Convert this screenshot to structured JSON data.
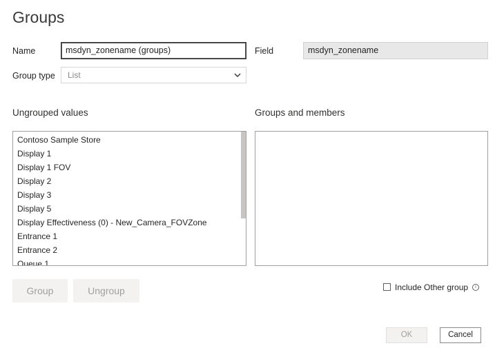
{
  "dialog": {
    "title": "Groups",
    "name_label": "Name",
    "name_value": "msdyn_zonename (groups)",
    "field_label": "Field",
    "field_value": "msdyn_zonename",
    "group_type_label": "Group type",
    "group_type_value": "List",
    "ungrouped_heading": "Ungrouped values",
    "groups_heading": "Groups and members",
    "ungrouped_values": [
      "Contoso Sample Store",
      "Display 1",
      "Display 1 FOV",
      "Display 2",
      "Display 3",
      "Display 5",
      "Display Effectiveness (0) - New_Camera_FOVZone",
      "Entrance 1",
      "Entrance 2",
      "Queue 1"
    ],
    "group_button": "Group",
    "ungroup_button": "Ungroup",
    "include_other_label": "Include Other group",
    "info_icon": "i",
    "ok_button": "OK",
    "cancel_button": "Cancel"
  },
  "icons": {
    "dropdown": "chevron-down-icon",
    "info": "info-icon"
  },
  "colors": {
    "disabled_button_bg": "#f3f2f1",
    "disabled_text": "#a19f9d",
    "readonly_field_bg": "#e8e8e8"
  }
}
